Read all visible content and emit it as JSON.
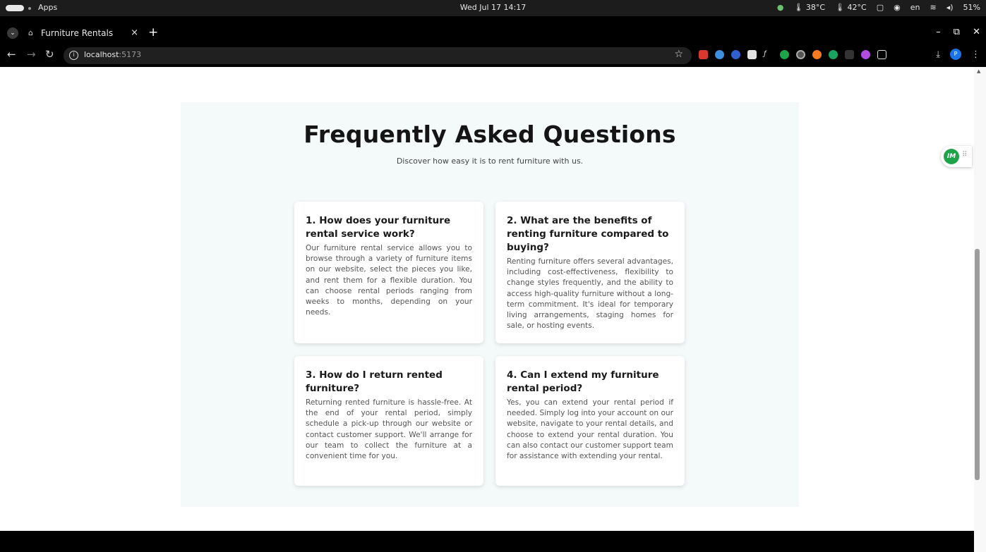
{
  "os_bar": {
    "apps_label": "Apps",
    "clock": "Wed Jul 17  14:17",
    "temp1": "🌡 38°C",
    "temp2": "🌡 42°C",
    "lang": "en",
    "battery": "51%"
  },
  "browser": {
    "tab_title": "Furniture Rentals",
    "url_host": "localhost",
    "url_port": ":5173",
    "profile_initial": "P"
  },
  "faq": {
    "title": "Frequently Asked Questions",
    "subtitle": "Discover how easy it is to rent furniture with us.",
    "items": [
      {
        "question": "1. How does your furniture rental service work?",
        "answer": "Our furniture rental service allows you to browse through a variety of furniture items on our website, select the pieces you like, and rent them for a flexible duration. You can choose rental periods ranging from weeks to months, depending on your needs."
      },
      {
        "question": "2. What are the benefits of renting furniture compared to buying?",
        "answer": "Renting furniture offers several advantages, including cost-effectiveness, flexibility to change styles frequently, and the ability to access high-quality furniture without a long-term commitment. It's ideal for temporary living arrangements, staging homes for sale, or hosting events."
      },
      {
        "question": "3. How do I return rented furniture?",
        "answer": "Returning rented furniture is hassle-free. At the end of your rental period, simply schedule a pick-up through our website or contact customer support. We'll arrange for our team to collect the furniture at a convenient time for you."
      },
      {
        "question": "4. Can I extend my furniture rental period?",
        "answer": "Yes, you can extend your rental period if needed. Simply log into your account on our website, navigate to your rental details, and choose to extend your rental duration. You can also contact our customer support team for assistance with extending your rental."
      }
    ]
  },
  "floating_badge": {
    "logo_text": "IM"
  },
  "colors": {
    "section_bg": "#f4f9fa",
    "card_bg": "#ffffff",
    "badge_green": "#1ea34a"
  }
}
